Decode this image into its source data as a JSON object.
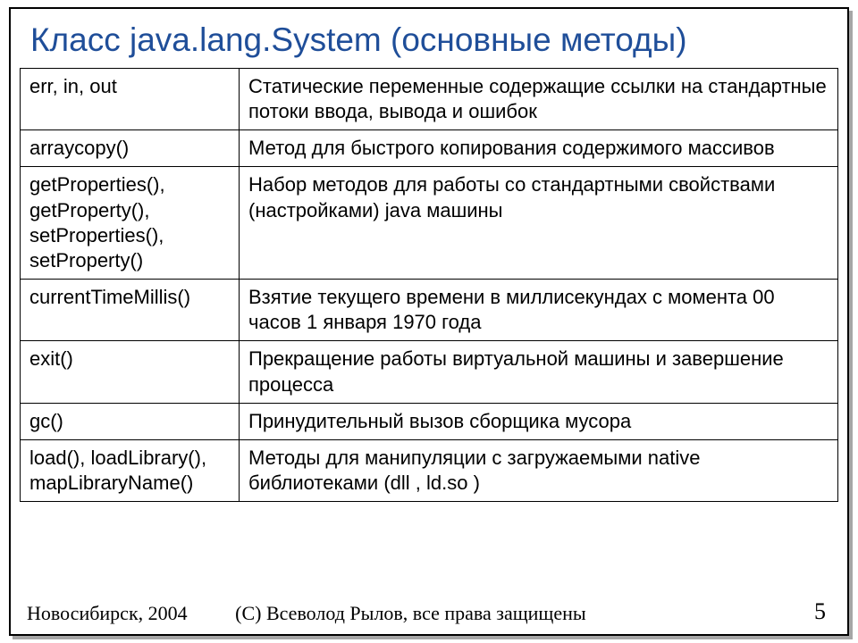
{
  "title": "Класс java.lang.System (основные методы)",
  "rows": [
    {
      "method": "err, in, out",
      "desc": "Статические переменные содержащие ссылки на стандартные потоки ввода, вывода и ошибок"
    },
    {
      "method": "arraycopy()",
      "desc": "Метод для быстрого копирования содержимого массивов"
    },
    {
      "method": "getProperties(), getProperty(), setProperties(), setProperty()",
      "desc": "Набор методов для работы со стандартными свойствами (настройками) java машины"
    },
    {
      "method": "currentTimeMillis()",
      "desc": "Взятие текущего времени в миллисекундах с момента 00 часов 1 января 1970 года"
    },
    {
      "method": "exit()",
      "desc": "Прекращение работы виртуальной машины и завершение процесса"
    },
    {
      "method": "gc()",
      "desc": "Принудительный вызов сборщика мусора"
    },
    {
      "method": "load(), loadLibrary(), mapLibraryName()",
      "desc": "Методы для манипуляции с загружаемыми native библиотеками (dll , ld.so )"
    }
  ],
  "footer": {
    "location": "Новосибирск, 2004",
    "copyright": "(С) Всеволод Рылов, все права защищены",
    "page": "5"
  }
}
